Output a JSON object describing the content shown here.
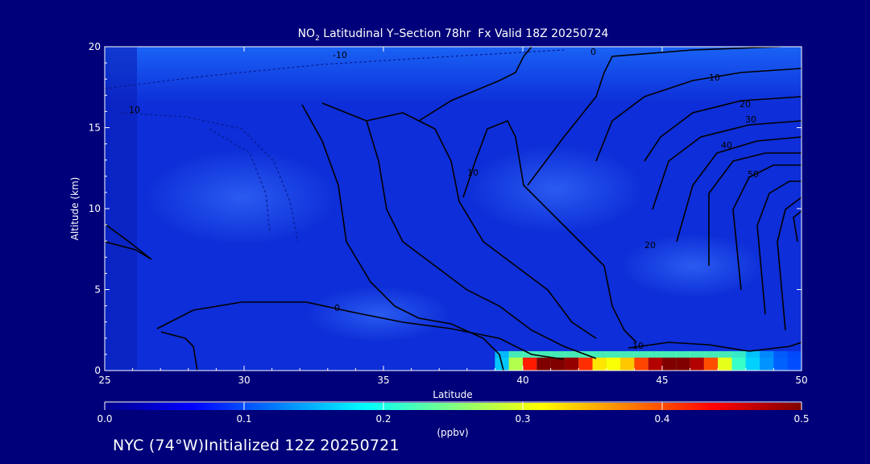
{
  "page": {
    "background": "#00007a"
  },
  "chart_data": {
    "type": "heatmap",
    "title_prefix": "NO",
    "title_subscript": "2",
    "title_rest": " Latitudinal Y–Section 78hr  Fx Valid 18Z 20250724",
    "xlabel": "Latitude",
    "ylabel": "Altitude (km)",
    "xlim": [
      25,
      50
    ],
    "ylim": [
      0,
      20
    ],
    "xticks": [
      25,
      30,
      35,
      40,
      45,
      50
    ],
    "yticks": [
      0,
      5,
      10,
      15,
      20
    ],
    "colorbar": {
      "label": "(ppbv)",
      "range": [
        0.0,
        0.5
      ],
      "ticks": [
        "0.0",
        "0.1",
        "0.2",
        "0.3",
        "0.4",
        "0.5"
      ],
      "colormap": [
        "#00008f",
        "#0000ff",
        "#0080ff",
        "#00ffff",
        "#80ff80",
        "#ffff00",
        "#ff8000",
        "#ff0000",
        "#800000"
      ]
    },
    "field_background_ppbv": 0.06,
    "surface_plume": {
      "altitude_km": [
        0,
        1.0
      ],
      "latitudes": [
        39.0,
        39.5,
        40.0,
        40.5,
        41.0,
        41.5,
        42.0,
        42.5,
        43.0,
        43.5,
        44.0,
        44.5,
        45.0,
        45.5,
        46.0,
        46.5,
        47.0,
        47.5,
        48.0,
        48.5,
        49.0,
        49.5,
        50.0
      ],
      "values_ppbv": [
        0.12,
        0.2,
        0.35,
        0.5,
        0.5,
        0.5,
        0.48,
        0.35,
        0.3,
        0.32,
        0.36,
        0.45,
        0.5,
        0.5,
        0.5,
        0.45,
        0.35,
        0.25,
        0.18,
        0.15,
        0.12,
        0.1,
        0.1
      ]
    },
    "contour_labels": [
      "-10",
      "0",
      "10",
      "20",
      "30",
      "40",
      "50"
    ],
    "footer": "NYC (74°W)Initialized 12Z 20250721"
  }
}
